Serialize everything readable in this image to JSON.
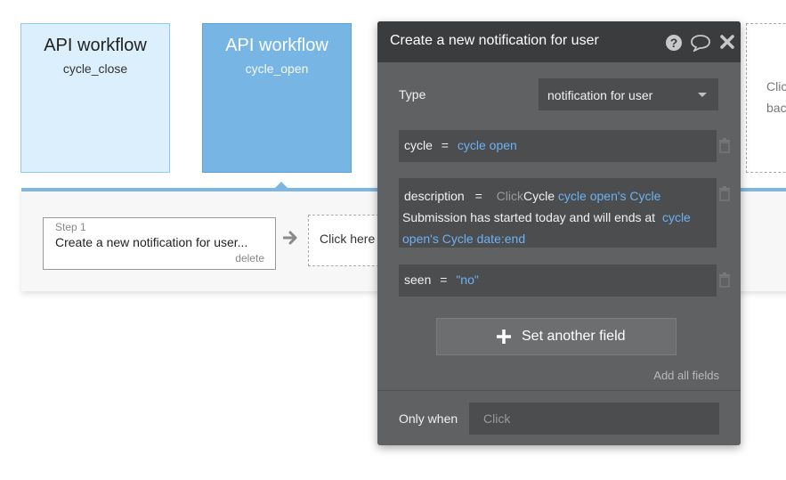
{
  "workflows": [
    {
      "title": "API workflow",
      "name": "cycle_close"
    },
    {
      "title": "API workflow",
      "name": "cycle_open"
    }
  ],
  "right_card": {
    "line1": "Clic",
    "line2": "back"
  },
  "step": {
    "label": "Step 1",
    "title": "Create a new notification for user...",
    "delete_label": "delete"
  },
  "click_here_label": "Click here",
  "panel": {
    "title": "Create a new notification for user",
    "type_label": "Type",
    "type_value": "notification for user",
    "fields": {
      "cycle": {
        "name": "cycle",
        "op": "=",
        "value": "cycle open"
      },
      "description": {
        "name": "description",
        "op": "=",
        "click_hint": "Click",
        "text1": "Cycle",
        "dyn1": "cycle open's Cycle",
        "text2": "Submission has started today and will ends at",
        "dyn2": "cycle open's Cycle date:end"
      },
      "seen": {
        "name": "seen",
        "op": "=",
        "value": "\"no\""
      }
    },
    "set_field_label": "Set another field",
    "add_all_label": "Add all fields",
    "only_when_label": "Only when",
    "only_when_placeholder": "Click"
  },
  "colors": {
    "panel_bg": "#5f6163",
    "panel_header": "#3a3c3e",
    "dynamic_text": "#6cb2f2",
    "card_light": "#dbf0fc",
    "card_active": "#77b6e4"
  }
}
